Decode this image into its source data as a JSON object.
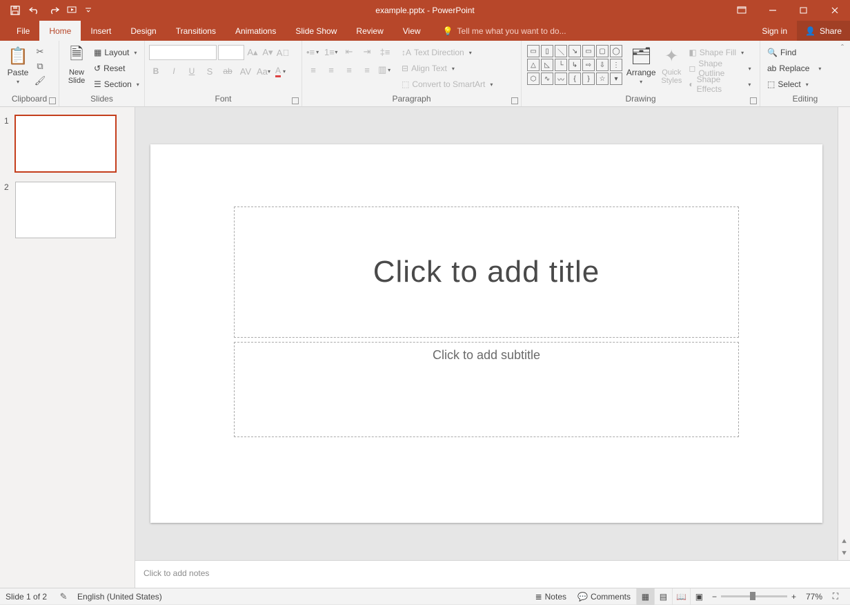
{
  "window": {
    "title": "example.pptx - PowerPoint"
  },
  "menubar": {
    "tabs": [
      "File",
      "Home",
      "Insert",
      "Design",
      "Transitions",
      "Animations",
      "Slide Show",
      "Review",
      "View"
    ],
    "active_index": 1,
    "tell_me": "Tell me what you want to do...",
    "sign_in": "Sign in",
    "share": "Share"
  },
  "ribbon": {
    "clipboard": {
      "label": "Clipboard",
      "paste": "Paste"
    },
    "slides": {
      "label": "Slides",
      "new_slide": "New\nSlide",
      "layout": "Layout",
      "reset": "Reset",
      "section": "Section"
    },
    "font": {
      "label": "Font"
    },
    "paragraph": {
      "label": "Paragraph",
      "text_direction": "Text Direction",
      "align_text": "Align Text",
      "convert_smartart": "Convert to SmartArt"
    },
    "drawing": {
      "label": "Drawing",
      "arrange": "Arrange",
      "quick_styles": "Quick\nStyles",
      "shape_fill": "Shape Fill",
      "shape_outline": "Shape Outline",
      "shape_effects": "Shape Effects"
    },
    "editing": {
      "label": "Editing",
      "find": "Find",
      "replace": "Replace",
      "select": "Select"
    }
  },
  "thumbnails": [
    {
      "number": "1"
    },
    {
      "number": "2"
    }
  ],
  "slide": {
    "title_placeholder": "Click to add title",
    "subtitle_placeholder": "Click to add subtitle"
  },
  "notes": {
    "placeholder": "Click to add notes"
  },
  "status": {
    "slide_info": "Slide 1 of 2",
    "language": "English (United States)",
    "notes": "Notes",
    "comments": "Comments",
    "zoom": "77%"
  }
}
